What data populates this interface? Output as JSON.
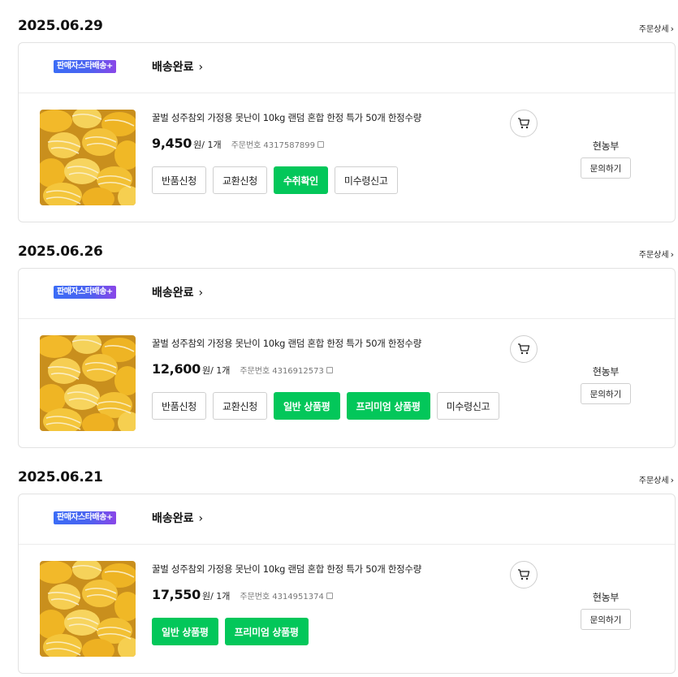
{
  "orders": [
    {
      "date": "2025.06.29",
      "detail_label": "주문상세",
      "seller_badge": "판매자스타배송+",
      "status": "배송완료",
      "product_name": "꿀벌 성주참외 가정용 못난이 10kg 랜덤 혼합 한정 특가 50개 한정수량",
      "price": "9,450",
      "price_unit": "원",
      "qty": "/ 1개",
      "order_no_label": "주문번호",
      "order_no": "4317587899",
      "buttons": [
        {
          "label": "반품신청",
          "style": "outline"
        },
        {
          "label": "교환신청",
          "style": "outline"
        },
        {
          "label": "수취확인",
          "style": "green"
        },
        {
          "label": "미수령신고",
          "style": "outline"
        }
      ],
      "seller_name": "현농부",
      "inquiry_label": "문의하기"
    },
    {
      "date": "2025.06.26",
      "detail_label": "주문상세",
      "seller_badge": "판매자스타배송+",
      "status": "배송완료",
      "product_name": "꿀벌 성주참외 가정용 못난이 10kg 랜덤 혼합 한정 특가 50개 한정수량",
      "price": "12,600",
      "price_unit": "원",
      "qty": "/ 1개",
      "order_no_label": "주문번호",
      "order_no": "4316912573",
      "buttons": [
        {
          "label": "반품신청",
          "style": "outline"
        },
        {
          "label": "교환신청",
          "style": "outline"
        },
        {
          "label": "일반 상품평",
          "style": "green"
        },
        {
          "label": "프리미엄 상품평",
          "style": "green"
        },
        {
          "label": "미수령신고",
          "style": "outline"
        }
      ],
      "seller_name": "현농부",
      "inquiry_label": "문의하기"
    },
    {
      "date": "2025.06.21",
      "detail_label": "주문상세",
      "seller_badge": "판매자스타배송+",
      "status": "배송완료",
      "product_name": "꿀벌 성주참외 가정용 못난이 10kg 랜덤 혼합 한정 특가 50개 한정수량",
      "price": "17,550",
      "price_unit": "원",
      "qty": "/ 1개",
      "order_no_label": "주문번호",
      "order_no": "4314951374",
      "buttons": [
        {
          "label": "일반 상품평",
          "style": "green"
        },
        {
          "label": "프리미엄 상품평",
          "style": "green"
        }
      ],
      "seller_name": "현농부",
      "inquiry_label": "문의하기"
    }
  ],
  "icons": {
    "cart": "shopping-cart-icon",
    "copy": "copy-icon",
    "chevron": "chevron-right-icon"
  },
  "colors": {
    "primary_green": "#03c75a",
    "badge_gradient_start": "#3b6cf6",
    "badge_gradient_end": "#8a46e8"
  }
}
